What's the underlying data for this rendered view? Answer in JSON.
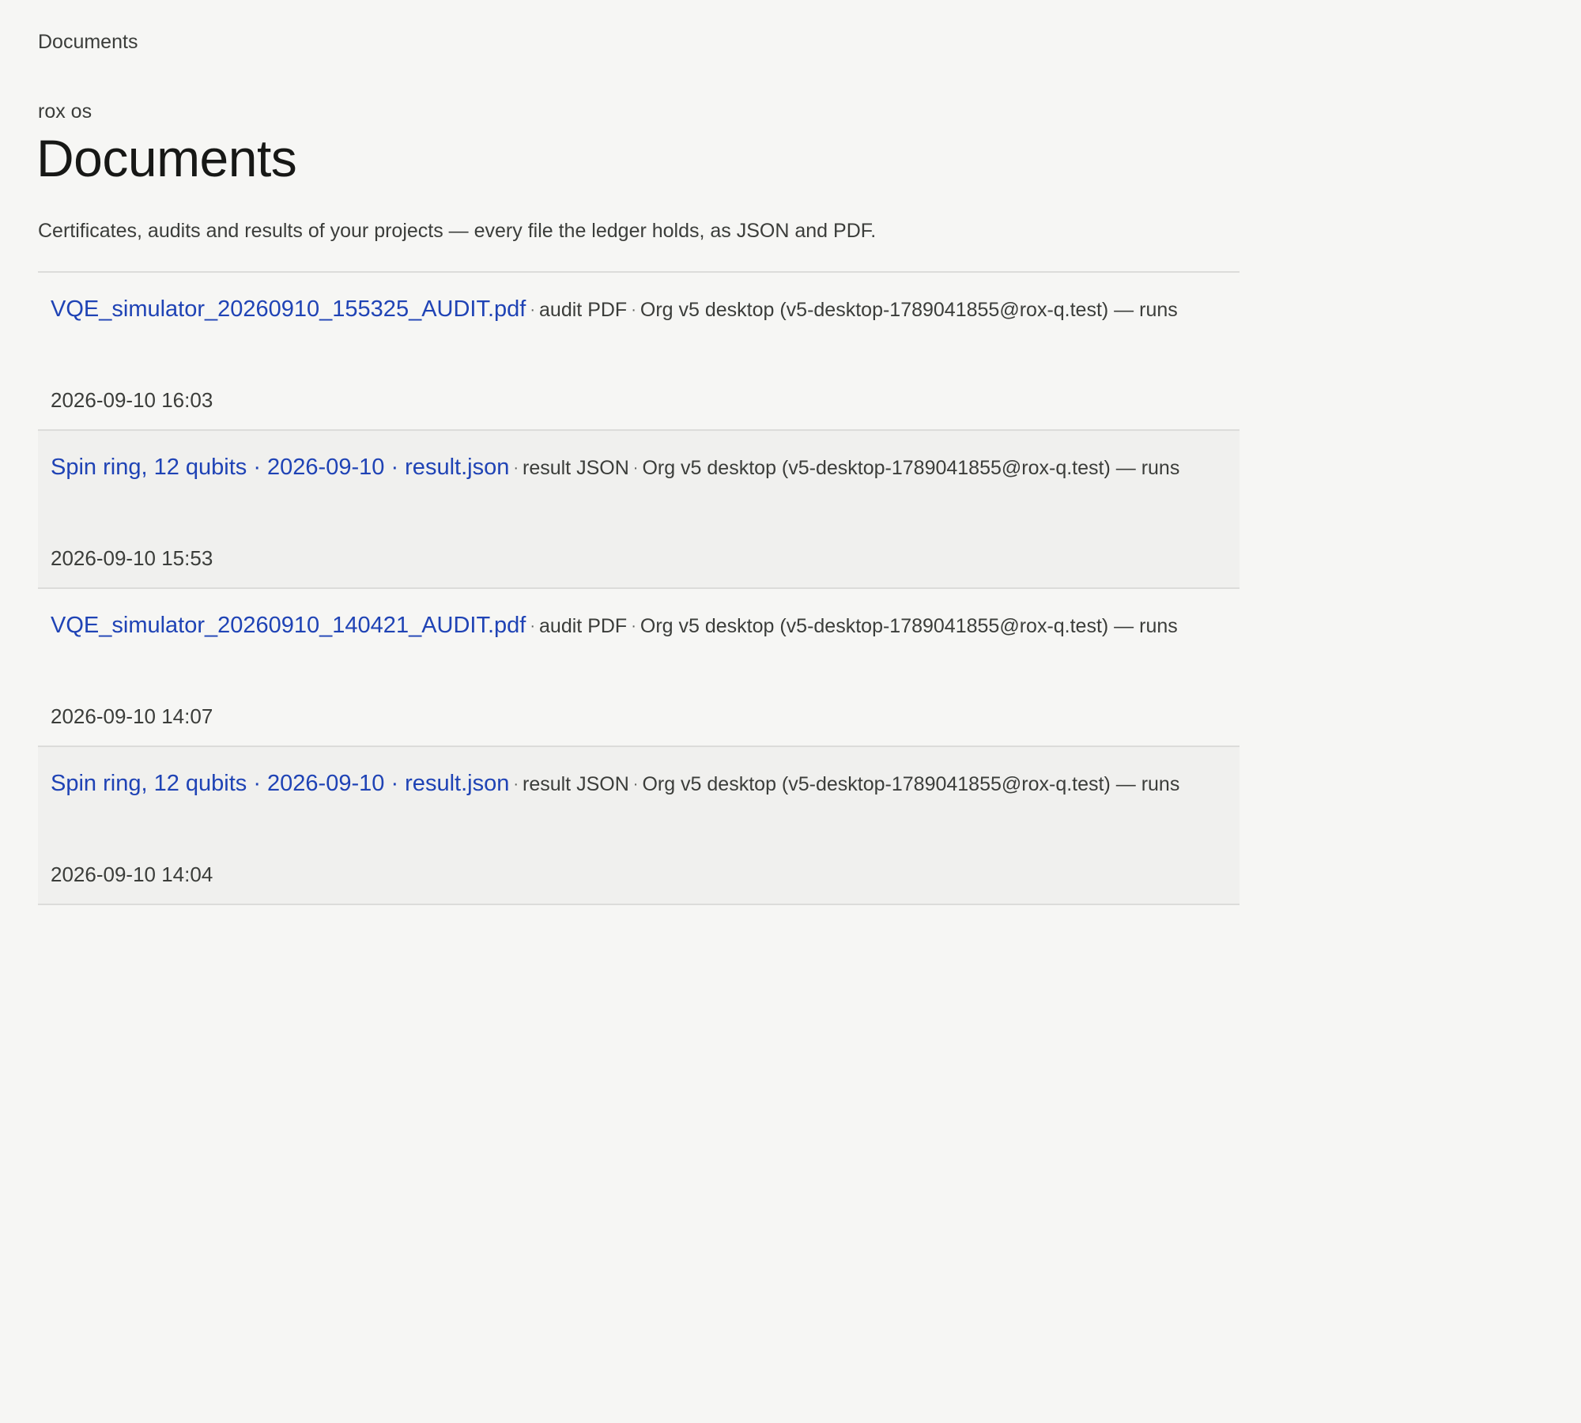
{
  "breadcrumb": "Documents",
  "header": {
    "eyebrow": "rox os",
    "title": "Documents",
    "subtitle": "Certificates, audits and results of your projects — every file the ledger holds, as JSON and PDF."
  },
  "separator": "·",
  "documents": [
    {
      "name": "VQE_simulator_20260910_155325_AUDIT.pdf",
      "kind": "audit PDF",
      "owner": "Org v5 desktop (v5-desktop-1789041855@rox-q.test) — runs",
      "date": "2026-09-10 16:03"
    },
    {
      "name": "Spin ring, 12 qubits · 2026-09-10 · result.json",
      "kind": "result JSON",
      "owner": "Org v5 desktop (v5-desktop-1789041855@rox-q.test) — runs",
      "date": "2026-09-10 15:53"
    },
    {
      "name": "VQE_simulator_20260910_140421_AUDIT.pdf",
      "kind": "audit PDF",
      "owner": "Org v5 desktop (v5-desktop-1789041855@rox-q.test) — runs",
      "date": "2026-09-10 14:07"
    },
    {
      "name": "Spin ring, 12 qubits · 2026-09-10 · result.json",
      "kind": "result JSON",
      "owner": "Org v5 desktop (v5-desktop-1789041855@rox-q.test) — runs",
      "date": "2026-09-10 14:04"
    }
  ]
}
